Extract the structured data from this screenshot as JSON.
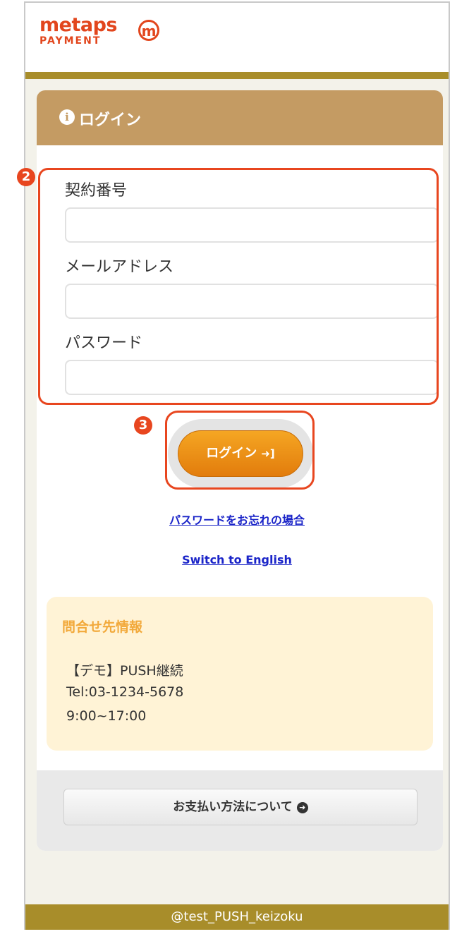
{
  "header": {
    "logo_top": "metaps",
    "logo_bottom": "PAYMENT",
    "logo_mark": "m"
  },
  "panel": {
    "title": "ログイン",
    "icon": "info-icon"
  },
  "form": {
    "contract_label": "契約番号",
    "contract_value": "",
    "email_label": "メールアドレス",
    "email_value": "",
    "password_label": "パスワード",
    "password_value": ""
  },
  "badges": {
    "fields": "2",
    "login": "3"
  },
  "login_button": {
    "label": "ログイン",
    "icon": "sign-in-icon"
  },
  "links": {
    "forgot_password": "パスワードをお忘れの場合",
    "switch_language": "Switch to English"
  },
  "contact": {
    "title": "問合せ先情報",
    "name": "【デモ】PUSH継続",
    "tel": "Tel:03-1234-5678",
    "hours": "9:00~17:00"
  },
  "payment_button": {
    "label": "お支払い方法について",
    "icon": "arrow-circle-right-icon"
  },
  "footer": {
    "account": "@test_PUSH_keizoku"
  },
  "colors": {
    "brand": "#e2461d",
    "gold": "#a88d2a",
    "panel_header": "#c49b63",
    "button_orange": "#f0901a",
    "highlight": "#e8461f",
    "contact_bg": "#fff3d6"
  }
}
